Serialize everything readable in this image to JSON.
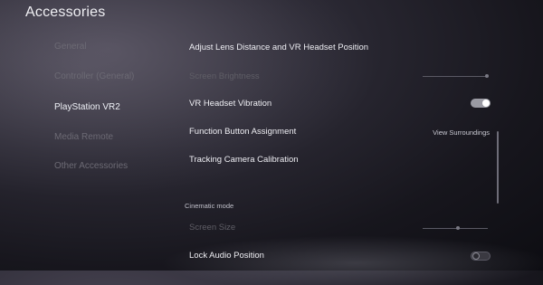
{
  "header": {
    "title": "Accessories"
  },
  "sidebar": {
    "items": [
      {
        "label": "General"
      },
      {
        "label": "Controller (General)"
      },
      {
        "label": "PlayStation VR2"
      },
      {
        "label": "Media Remote"
      },
      {
        "label": "Other Accessories"
      }
    ]
  },
  "settings": {
    "adjust_lens": {
      "label": "Adjust Lens Distance and VR Headset Position"
    },
    "screen_brightness": {
      "label": "Screen Brightness",
      "level": 0.96
    },
    "vr_vibration": {
      "label": "VR Headset Vibration",
      "state": "on"
    },
    "function_button": {
      "label": "Function Button Assignment",
      "value": "View Surroundings"
    },
    "tracking_camera": {
      "label": "Tracking Camera Calibration"
    },
    "cinematic_header": {
      "label": "Cinematic mode"
    },
    "screen_size": {
      "label": "Screen Size",
      "level": 0.55
    },
    "lock_audio": {
      "label": "Lock Audio Position",
      "state": "off"
    }
  },
  "colors": {
    "background": "#17161d",
    "text_active": "#eeeef3",
    "text_dim": "#5f5e66"
  }
}
